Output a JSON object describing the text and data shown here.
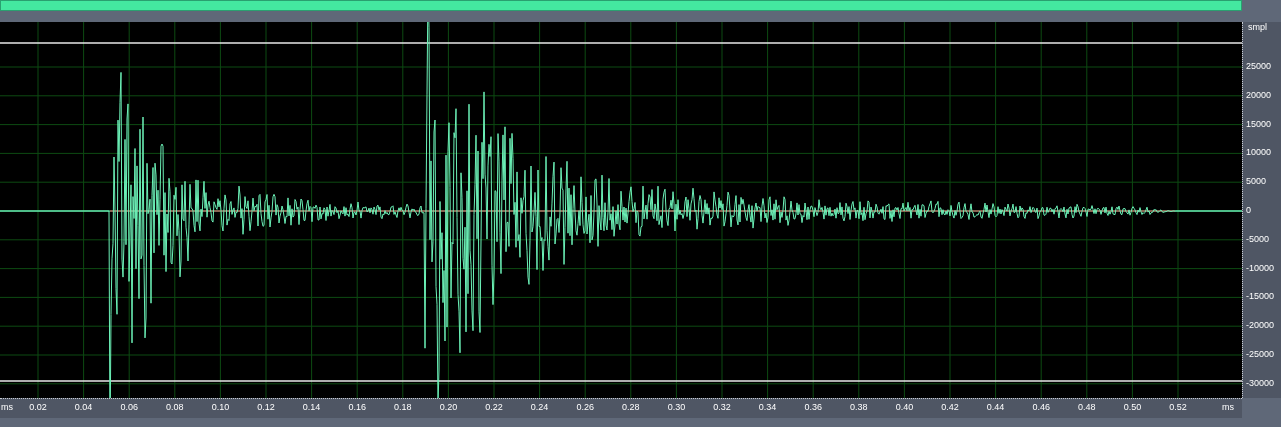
{
  "y_axis": {
    "unit": "smpl",
    "labels": [
      "25000",
      "20000",
      "15000",
      "10000",
      "5000",
      "0",
      "-5000",
      "-10000",
      "-15000",
      "-20000",
      "-25000",
      "-30000"
    ]
  },
  "x_axis": {
    "start_unit": "ms",
    "labels": [
      "0.02",
      "0.04",
      "0.06",
      "0.08",
      "0.10",
      "0.12",
      "0.14",
      "0.16",
      "0.18",
      "0.20",
      "0.22",
      "0.24",
      "0.26",
      "0.28",
      "0.30",
      "0.32",
      "0.34",
      "0.36",
      "0.38",
      "0.40",
      "0.42",
      "0.44",
      "0.46",
      "0.48",
      "0.50",
      "0.52"
    ],
    "end_unit": "ms"
  }
}
